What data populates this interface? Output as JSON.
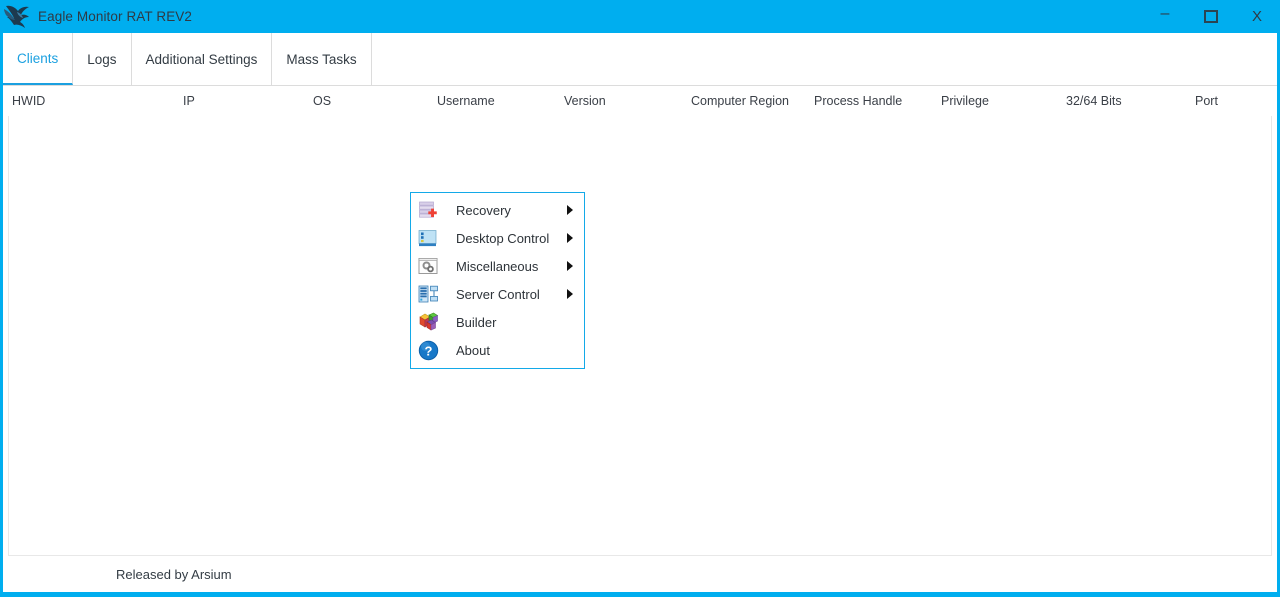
{
  "window": {
    "title": "Eagle Monitor RAT REV2",
    "logo_icon": "eagle-logo-icon",
    "controls": {
      "minimize_label": "–",
      "maximize_label": "",
      "close_label": "X"
    },
    "accent_color": "#00AEEF",
    "border_color": "#00AEEF"
  },
  "tabs": [
    {
      "label": "Clients",
      "active": true
    },
    {
      "label": "Logs",
      "active": false
    },
    {
      "label": "Additional Settings",
      "active": false
    },
    {
      "label": "Mass Tasks",
      "active": false
    }
  ],
  "grid": {
    "columns": [
      {
        "label": "HWID"
      },
      {
        "label": "IP"
      },
      {
        "label": "OS"
      },
      {
        "label": "Username"
      },
      {
        "label": "Version"
      },
      {
        "label": "Computer Region"
      },
      {
        "label": "Process Handle"
      },
      {
        "label": "Privilege"
      },
      {
        "label": "32/64 Bits"
      },
      {
        "label": "Port"
      }
    ],
    "rows": []
  },
  "context_menu": {
    "items": [
      {
        "label": "Recovery",
        "icon": "recovery-icon",
        "has_submenu": true
      },
      {
        "label": "Desktop Control",
        "icon": "desktop-control-icon",
        "has_submenu": true
      },
      {
        "label": "Miscellaneous",
        "icon": "miscellaneous-icon",
        "has_submenu": true
      },
      {
        "label": "Server Control",
        "icon": "server-control-icon",
        "has_submenu": true
      },
      {
        "label": "Builder",
        "icon": "builder-icon",
        "has_submenu": false
      },
      {
        "label": "About",
        "icon": "about-icon",
        "has_submenu": false
      }
    ],
    "border_color": "#13A9E8"
  },
  "status_bar": {
    "text": "Released by Arsium"
  }
}
